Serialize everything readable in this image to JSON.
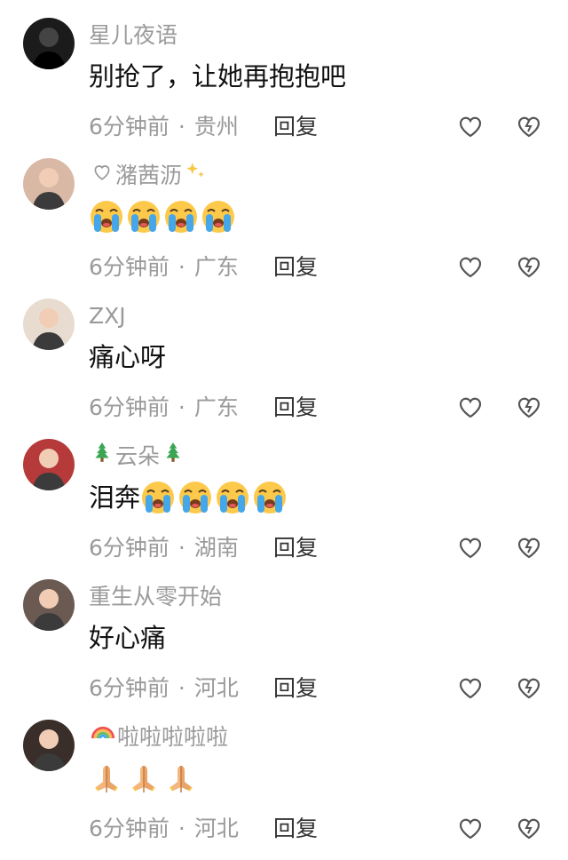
{
  "comments": [
    {
      "user": "星儿夜语",
      "text": "别抢了，让她再抱抱吧",
      "emoji": [],
      "time": "6分钟前",
      "location": "贵州",
      "reply": "回复",
      "name_prefix": "",
      "name_suffix": "",
      "avatar_color": "#1b1b1b"
    },
    {
      "user": "潴茜沥",
      "text": "",
      "emoji": [
        "loudly-crying-face",
        "loudly-crying-face",
        "loudly-crying-face",
        "loudly-crying-face"
      ],
      "time": "6分钟前",
      "location": "广东",
      "reply": "回复",
      "name_prefix": "heart-outline",
      "name_suffix": "sparkles",
      "avatar_color": "#d9b8a6"
    },
    {
      "user": "ZXJ",
      "text": "痛心呀",
      "emoji": [],
      "time": "6分钟前",
      "location": "广东",
      "reply": "回复",
      "name_prefix": "",
      "name_suffix": "",
      "avatar_color": "#e8dcd0"
    },
    {
      "user": "云朵",
      "text": "泪奔",
      "emoji": [
        "loudly-crying-face",
        "loudly-crying-face",
        "loudly-crying-face",
        "loudly-crying-face"
      ],
      "time": "6分钟前",
      "location": "湖南",
      "reply": "回复",
      "name_prefix": "christmas-tree",
      "name_suffix": "christmas-tree",
      "avatar_color": "#b63a3a"
    },
    {
      "user": "重生从零开始",
      "text": "好心痛",
      "emoji": [],
      "time": "6分钟前",
      "location": "河北",
      "reply": "回复",
      "name_prefix": "",
      "name_suffix": "",
      "avatar_color": "#6a5a52"
    },
    {
      "user": "啦啦啦啦啦",
      "text": "",
      "emoji": [
        "folded-hands",
        "folded-hands",
        "folded-hands"
      ],
      "time": "6分钟前",
      "location": "河北",
      "reply": "回复",
      "name_prefix": "rainbow",
      "name_suffix": "",
      "avatar_color": "#3a2e2a"
    }
  ],
  "separator": "·"
}
